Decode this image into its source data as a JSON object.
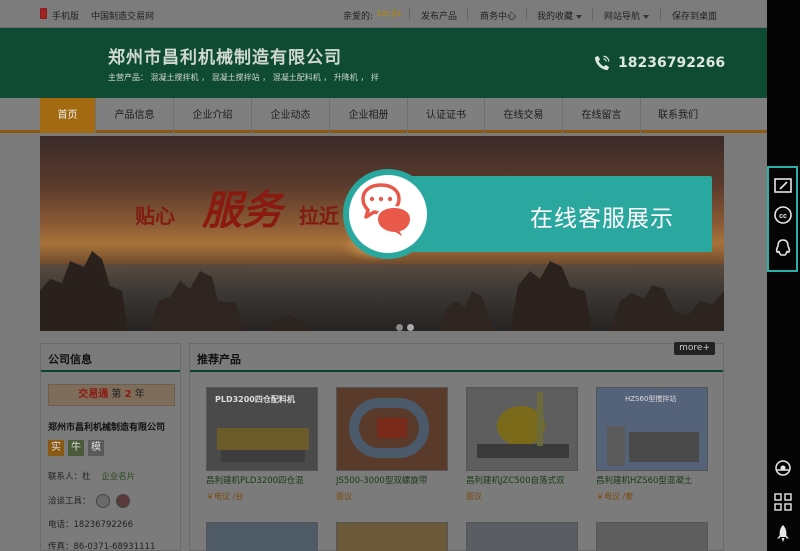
{
  "topbar": {
    "mobile_label": "手机版",
    "site_name": "中国制造交易网",
    "greeting": "亲爱的:",
    "user": "zzcjlx",
    "publish": "发布产品",
    "biz_center": "商务中心",
    "favorites": "我的收藏",
    "site_nav": "网站导航",
    "save_desktop": "保存到桌面"
  },
  "header": {
    "company_name": "郑州市昌利机械制造有限公司",
    "business": "主营产品： 混凝土搅拌机 ， 混凝土搅拌站 ， 混凝土配料机 ， 升降机 ， 拌",
    "phone": "18236792266"
  },
  "nav": {
    "tabs": [
      "首页",
      "产品信息",
      "企业介绍",
      "企业动态",
      "企业相册",
      "认证证书",
      "在线交易",
      "在线留言",
      "联系我们"
    ],
    "active": "首页"
  },
  "banner": {
    "slogan_left": "贴心",
    "slogan_mid": "服务",
    "slogan_right": "拉近"
  },
  "company_info": {
    "title": "公司信息",
    "jyt_brand": "交易通",
    "jyt_prefix": "第",
    "jyt_years": "2",
    "jyt_suffix": "年",
    "name": "郑州市昌利机械制造有限公司",
    "badges": [
      "实",
      "牛",
      "模"
    ],
    "contact_label": "联系人：杜",
    "card_link": "企业名片",
    "tools_label": "洽谈工具：",
    "phone_line": "电话：18236792266",
    "fax_line": "传真：86-0371-68931111"
  },
  "products": {
    "title": "推荐产品",
    "more": "more+",
    "items": [
      {
        "name": "昌利建机PLD3200四仓混",
        "price": "￥电议 /台",
        "img_label": "PLD3200四仓配料机"
      },
      {
        "name": "JS500-3000型双螺旋带",
        "price": "面议",
        "img_label": ""
      },
      {
        "name": "昌利建机JZC500自落式双",
        "price": "面议",
        "img_label": ""
      },
      {
        "name": "昌利建机HZS60型混凝土",
        "price": "￥电议 /套",
        "img_label": "HZS60型搅拌站"
      }
    ]
  },
  "overlay": {
    "text": "在线客服展示"
  },
  "sidebar": {
    "icons": [
      "edit-icon",
      "cc-icon",
      "qq-icon",
      "service-icon",
      "apps-icon",
      "rocket-icon"
    ]
  },
  "colors": {
    "accent_teal": "#2aa8a0",
    "header_green": "#0f4a33",
    "nav_active": "#a36a12"
  }
}
